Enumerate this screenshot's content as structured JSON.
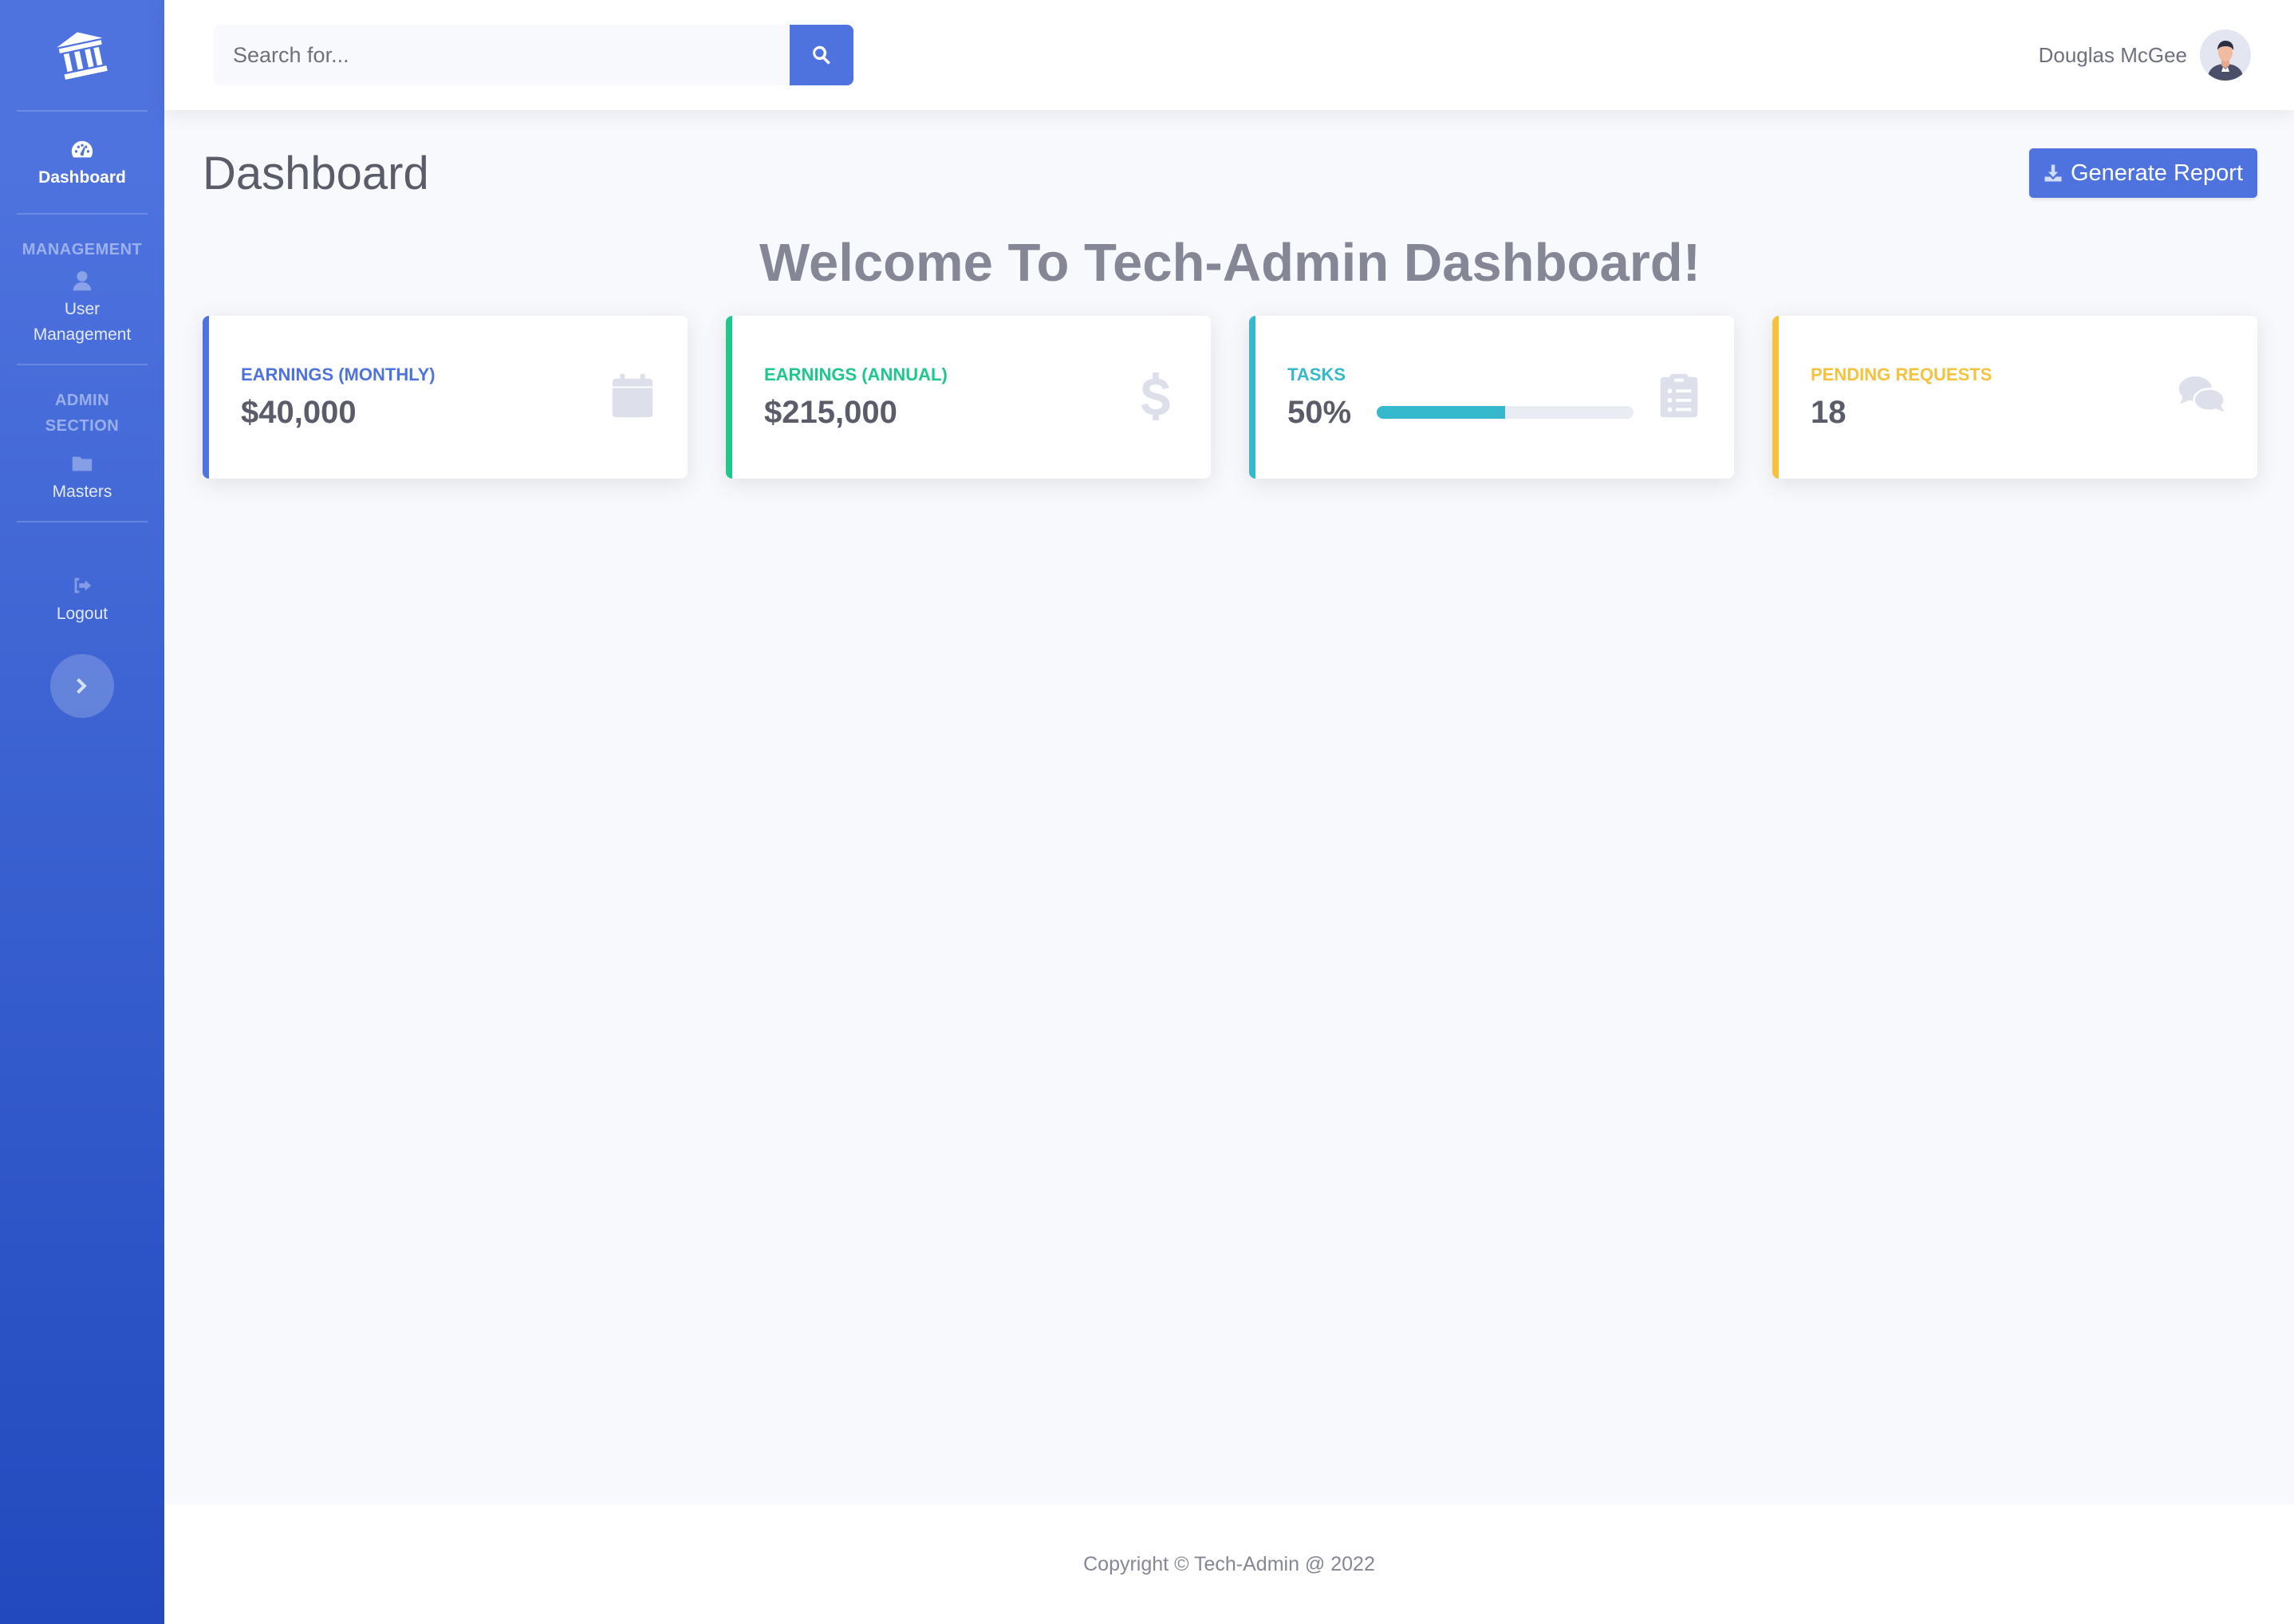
{
  "sidebar": {
    "brand_icon": "university-icon",
    "items": [
      {
        "label": "Dashboard",
        "icon": "tachometer-icon",
        "active": true
      },
      {
        "label": "User Management",
        "icon": "user-icon"
      },
      {
        "label": "Masters",
        "icon": "folder-icon"
      },
      {
        "label": "Logout",
        "icon": "sign-out-icon"
      }
    ],
    "headings": [
      "MANAGEMENT",
      "ADMIN SECTION"
    ],
    "toggle_icon": "chevron-right-icon"
  },
  "topbar": {
    "search_placeholder": "Search for...",
    "search_icon": "search-icon",
    "user_name": "Douglas McGee"
  },
  "main": {
    "title": "Dashboard",
    "report_button": "Generate Report",
    "report_icon": "download-icon",
    "welcome": "Welcome To Tech-Admin Dashboard!",
    "cards": [
      {
        "title": "EARNINGS (MONTHLY)",
        "value": "$40,000",
        "icon": "calendar-icon",
        "color": "#4e73df"
      },
      {
        "title": "EARNINGS (ANNUAL)",
        "value": "$215,000",
        "icon": "dollar-icon",
        "color": "#1cc88a"
      },
      {
        "title": "TASKS",
        "value": "50%",
        "progress": 0.5,
        "icon": "clipboard-list-icon",
        "color": "#36b9cc"
      },
      {
        "title": "PENDING REQUESTS",
        "value": "18",
        "icon": "comments-icon",
        "color": "#f6c23e"
      }
    ]
  },
  "footer": {
    "copyright": "Copyright © Tech-Admin @ 2022"
  },
  "colors": {
    "primary": "#4e73df",
    "success": "#1cc88a",
    "info": "#36b9cc",
    "warning": "#f6c23e"
  }
}
